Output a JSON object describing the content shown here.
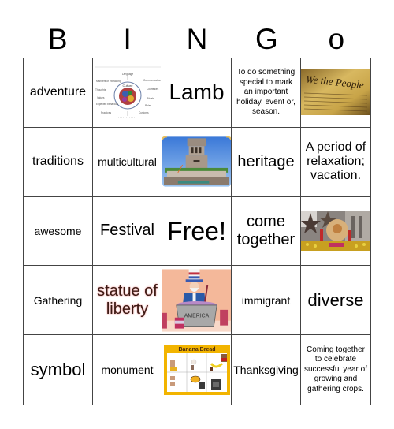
{
  "header": {
    "letters": [
      "B",
      "I",
      "N",
      "G",
      "o"
    ]
  },
  "cells": [
    {
      "type": "text",
      "text": "adventure",
      "size": "s-md"
    },
    {
      "type": "image",
      "icon": "culture-diagram-image",
      "alt": "Culture diagram"
    },
    {
      "type": "text",
      "text": "Lamb",
      "size": "s-xxl"
    },
    {
      "type": "text",
      "text": "To do something special to mark an important holiday, event or, season.",
      "size": "s-xs"
    },
    {
      "type": "image",
      "icon": "we-the-people-image",
      "alt": "We the People"
    },
    {
      "type": "text",
      "text": "traditions",
      "size": "s-md"
    },
    {
      "type": "text",
      "text": "multicultural",
      "size": "s-sm"
    },
    {
      "type": "image",
      "icon": "statue-pedestal-image",
      "alt": "Statue of Liberty pedestal"
    },
    {
      "type": "text",
      "text": "heritage",
      "size": "s-lg"
    },
    {
      "type": "text",
      "text": "A period of relaxation; vacation.",
      "size": "s-md"
    },
    {
      "type": "text",
      "text": "awesome",
      "size": "s-sm"
    },
    {
      "type": "text",
      "text": "Festival",
      "size": "s-lg"
    },
    {
      "type": "text",
      "text": "Free!",
      "size": "s-free"
    },
    {
      "type": "text",
      "text": "come together",
      "size": "s-lg"
    },
    {
      "type": "image",
      "icon": "parade-image",
      "alt": "Thanksgiving parade"
    },
    {
      "type": "text",
      "text": "Gathering",
      "size": "s-sm"
    },
    {
      "type": "text",
      "text": "statue of liberty",
      "size": "s-lg",
      "style": "glow"
    },
    {
      "type": "image",
      "icon": "melting-pot-image",
      "alt": "Uncle Sam melting pot",
      "label": "AMERICA"
    },
    {
      "type": "text",
      "text": "immigrant",
      "size": "s-sm"
    },
    {
      "type": "text",
      "text": "diverse",
      "size": "s-xl"
    },
    {
      "type": "text",
      "text": "symbol",
      "size": "s-xl"
    },
    {
      "type": "text",
      "text": "monument",
      "size": "s-sm"
    },
    {
      "type": "image",
      "icon": "banana-bread-image",
      "alt": "Banana Bread recipe",
      "label": "Banana Bread"
    },
    {
      "type": "text",
      "text": "Thanksgiving",
      "size": "s-sm"
    },
    {
      "type": "text",
      "text": "Coming together to celebrate successful year of growing and gathering crops.",
      "size": "s-xs"
    }
  ],
  "culture_diagram": {
    "center": "Culture",
    "labels": [
      "Language",
      "Communication",
      "Courtesies",
      "Rituals",
      "Roles",
      "Customs",
      "Practices",
      "Expected behaviors",
      "Values",
      "Thoughts",
      "Manners of interacting"
    ]
  },
  "image_text": {
    "we_the_people": "We the People",
    "melting_pot": "AMERICA",
    "banana_bread": "Banana Bread"
  }
}
